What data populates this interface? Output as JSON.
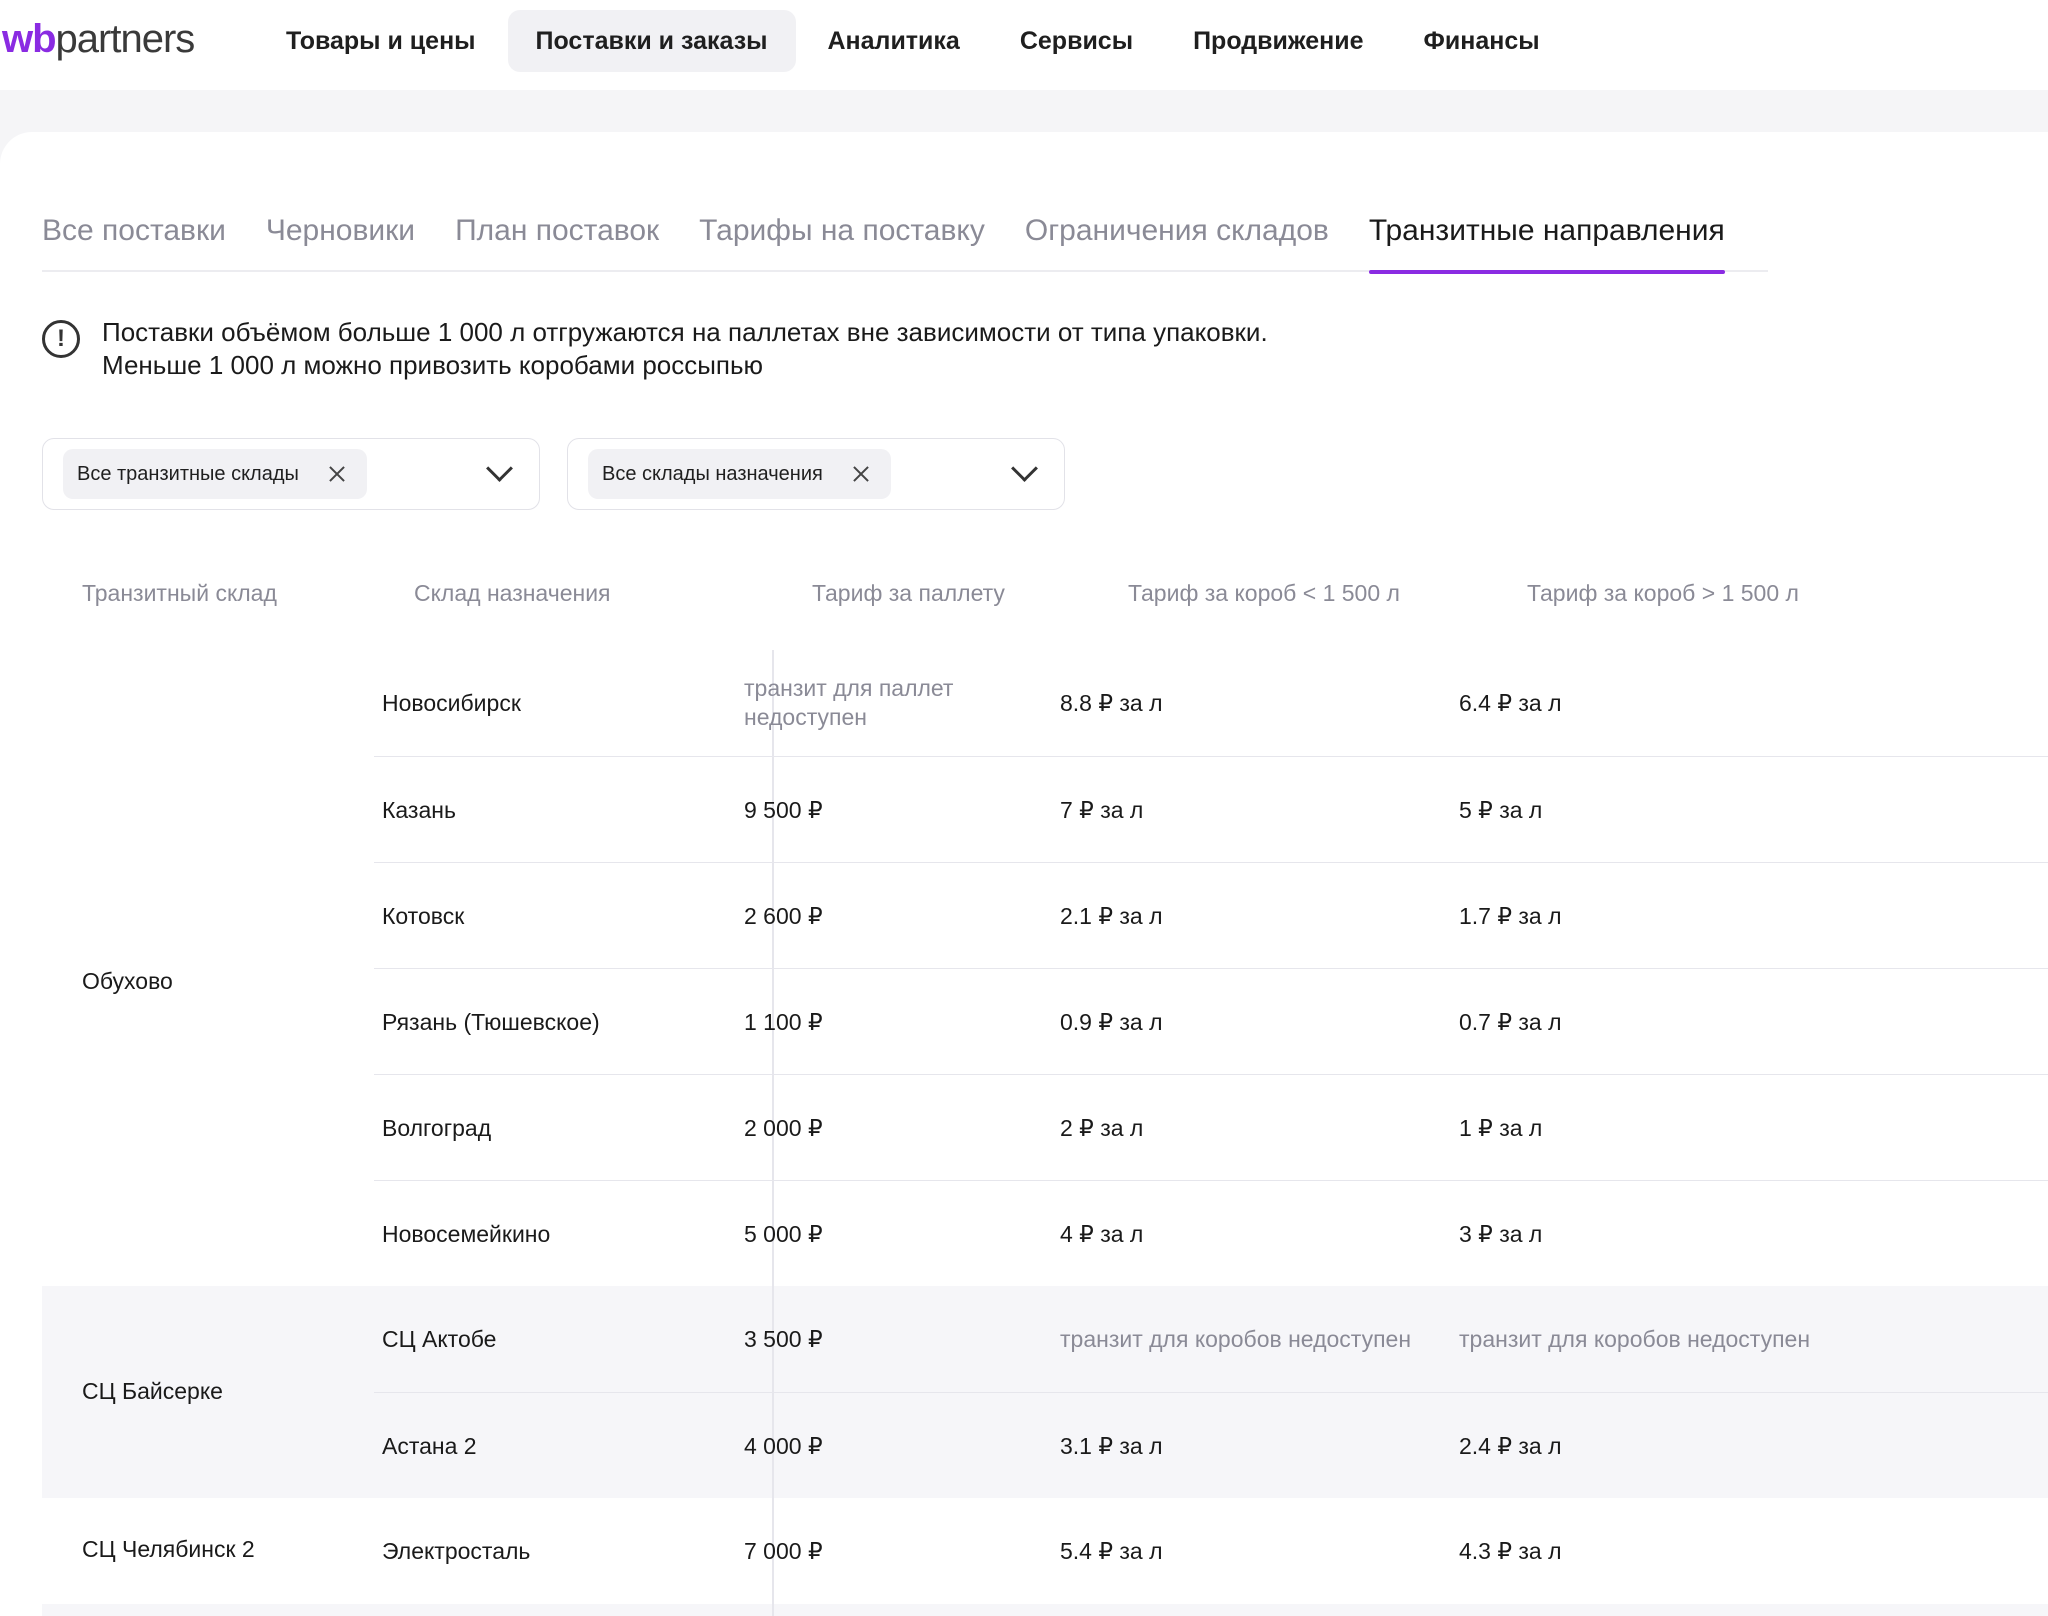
{
  "brand": {
    "wb": "wb",
    "partners": "partners"
  },
  "topnav": [
    {
      "label": "Товары и цены",
      "active": false
    },
    {
      "label": "Поставки и заказы",
      "active": true
    },
    {
      "label": "Аналитика",
      "active": false
    },
    {
      "label": "Сервисы",
      "active": false
    },
    {
      "label": "Продвижение",
      "active": false
    },
    {
      "label": "Финансы",
      "active": false
    }
  ],
  "tabs": [
    {
      "label": "Все поставки",
      "active": false
    },
    {
      "label": "Черновики",
      "active": false
    },
    {
      "label": "План поставок",
      "active": false
    },
    {
      "label": "Тарифы на поставку",
      "active": false
    },
    {
      "label": "Ограничения складов",
      "active": false
    },
    {
      "label": "Транзитные направления",
      "active": true
    }
  ],
  "notice": {
    "icon": "exclamation-circle-icon",
    "line1": "Поставки объёмом больше 1 000 л отгружаются на паллетах вне зависимости от типа упаковки.",
    "line2": "Меньше 1 000 л можно привозить коробами россыпью"
  },
  "filters": {
    "transit": {
      "chip": "Все транзитные склады"
    },
    "destination": {
      "chip": "Все склады назначения"
    }
  },
  "table": {
    "headers": {
      "transit": "Транзитный склад",
      "destination": "Склад назначения",
      "pallet": "Тариф за паллету",
      "box_small": "Тариф за короб < 1 500 л",
      "box_large": "Тариф за короб > 1 500 л"
    },
    "groups": [
      {
        "transit": "Обухово",
        "rows": [
          {
            "destination": "Новосибирск",
            "pallet": "транзит для паллет недоступен",
            "box_small": "8.8 ₽ за л",
            "box_large": "6.4 ₽ за л"
          },
          {
            "destination": "Казань",
            "pallet": "9 500 ₽",
            "box_small": "7 ₽ за л",
            "box_large": "5 ₽ за л"
          },
          {
            "destination": "Котовск",
            "pallet": "2 600 ₽",
            "box_small": "2.1 ₽ за л",
            "box_large": "1.7 ₽ за л"
          },
          {
            "destination": "Рязань (Тюшевское)",
            "pallet": "1 100 ₽",
            "box_small": "0.9 ₽ за л",
            "box_large": "0.7 ₽ за л"
          },
          {
            "destination": "Волгоград",
            "pallet": "2 000 ₽",
            "box_small": "2 ₽ за л",
            "box_large": "1 ₽ за л"
          },
          {
            "destination": "Новосемейкино",
            "pallet": "5 000 ₽",
            "box_small": "4 ₽ за л",
            "box_large": "3 ₽ за л"
          }
        ]
      },
      {
        "transit": "СЦ Байсерке",
        "rows": [
          {
            "destination": "СЦ Актобе",
            "pallet": "3 500 ₽",
            "box_small": "транзит для коробов недоступен",
            "box_large": "транзит для коробов недоступен"
          },
          {
            "destination": "Астана 2",
            "pallet": "4 000 ₽",
            "box_small": "3.1 ₽ за л",
            "box_large": "2.4 ₽ за л"
          }
        ]
      },
      {
        "transit": "СЦ Челябинск 2",
        "rows": [
          {
            "destination": "Электросталь",
            "pallet": "7 000 ₽",
            "box_small": "5.4 ₽ за л",
            "box_large": "4.3 ₽ за л"
          }
        ]
      }
    ]
  },
  "colors": {
    "accent": "#8a2be2",
    "muted": "#8a8a96",
    "shaded_row": "#f6f6f9"
  }
}
